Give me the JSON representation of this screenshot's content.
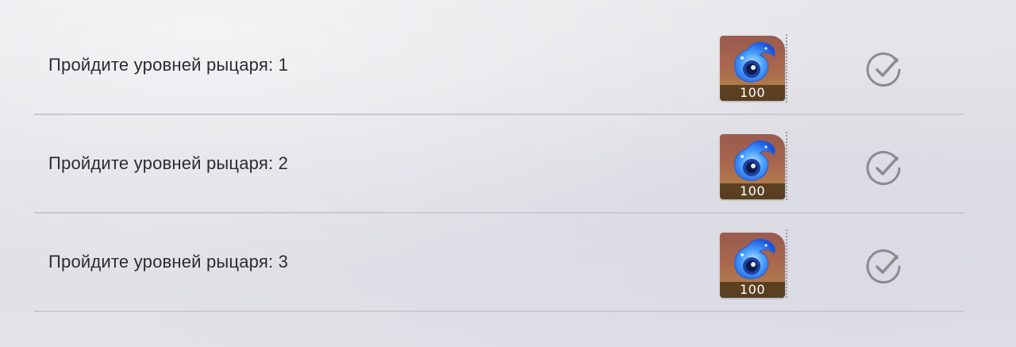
{
  "quests": [
    {
      "title": "Пройдите уровней рыцаря: 1",
      "reward": {
        "icon": "blue-crystal-orb-icon",
        "count": "100"
      },
      "status_icon": "check-circle-icon"
    },
    {
      "title": "Пройдите уровней рыцаря: 2",
      "reward": {
        "icon": "blue-crystal-orb-icon",
        "count": "100"
      },
      "status_icon": "check-circle-icon"
    },
    {
      "title": "Пройдите уровней рыцаря: 3",
      "reward": {
        "icon": "blue-crystal-orb-icon",
        "count": "100"
      },
      "status_icon": "check-circle-icon"
    }
  ],
  "colors": {
    "text": "#2b2b30",
    "divider": "#c9c9d1",
    "check": "#8a8a8f",
    "reward_bg": "#a8664d",
    "reward_count_bg": "#553c1e"
  }
}
